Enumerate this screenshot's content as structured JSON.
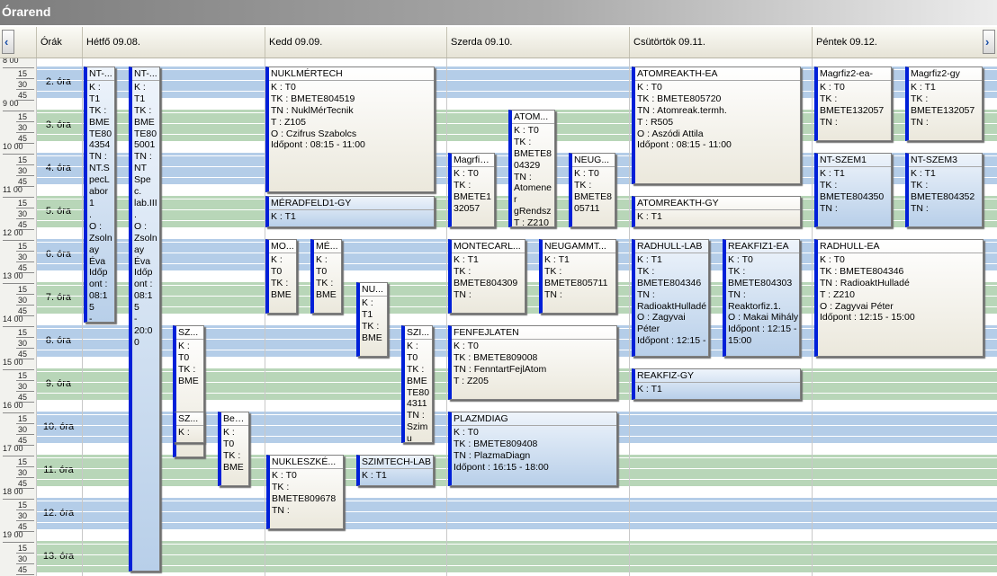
{
  "title": "Órarend",
  "header": {
    "hours_col": "Órák",
    "days": [
      "Hétfő  09.08.",
      "Kedd  09.09.",
      "Szerda  09.10.",
      "Csütörtök  09.11.",
      "Péntek  09.12."
    ]
  },
  "colors": {
    "band_blue": "#b4cde8",
    "band_green": "#b8d6b8",
    "event_accent": "#0020d8"
  },
  "icons": {
    "prev": "chevron-left-icon",
    "next": "chevron-right-icon"
  },
  "time_labels": [
    "8 00",
    "15",
    "30",
    "45",
    "9 00",
    "15",
    "30",
    "45",
    "10 00",
    "15",
    "30",
    "45",
    "11 00",
    "15",
    "30",
    "45",
    "12 00",
    "15",
    "30",
    "45",
    "13 00",
    "15",
    "30",
    "45",
    "14 00",
    "15",
    "30",
    "45",
    "15 00",
    "15",
    "30",
    "45",
    "16 00",
    "15",
    "30",
    "45",
    "17 00",
    "15",
    "30",
    "45",
    "18 00",
    "15",
    "30",
    "45",
    "19 00",
    "15",
    "30",
    "45"
  ],
  "periods": [
    "2. óra",
    "3. óra",
    "4. óra",
    "5. óra",
    "6. óra",
    "7. óra",
    "8. óra",
    "9. óra",
    "10. óra",
    "11. óra",
    "12. óra",
    "13. óra"
  ],
  "events": [
    {
      "title": "NT-...",
      "lines": [
        "K :",
        "T1",
        "TK :",
        "BME",
        "TE80",
        "4354",
        "TN :",
        "NT.S",
        "pecL",
        "abor1",
        ".",
        "O :",
        "Zsoln",
        "ay",
        "Éva",
        "Időp",
        "ont :",
        "08:15",
        "-"
      ]
    },
    {
      "title": "NT-...",
      "lines": [
        "K :",
        "T1",
        "TK :",
        "BME",
        "TE80",
        "5001",
        "TN :",
        "NT",
        "Spec.",
        "lab.III",
        ".",
        "O :",
        "Zsoln",
        "ay",
        "Éva",
        "Időp",
        "ont :",
        "08:15",
        "-",
        "20:00"
      ]
    },
    {
      "title": "SZ...",
      "lines": [
        "K :",
        "T0",
        "TK :",
        "BME"
      ]
    },
    {
      "title": "SZ...",
      "lines": [
        "K :"
      ]
    },
    {
      "title": "Bev...",
      "lines": [
        "K :",
        "T0",
        "TK :",
        "BME"
      ]
    },
    {
      "title": "NUKLMÉRTECH",
      "lines": [
        "K : T0",
        "TK : BMETE804519",
        "TN : NuklMérTecnik",
        "T : Z105",
        "O : Czifrus Szabolcs",
        "Időpont : 08:15 - 11:00"
      ]
    },
    {
      "title": "MÉRADFELD1-GY",
      "lines": [
        "K : T1"
      ]
    },
    {
      "title": "MO...",
      "lines": [
        "K :",
        "T0",
        "TK :",
        "BME"
      ]
    },
    {
      "title": "MÉ...",
      "lines": [
        "K :",
        "T0",
        "TK :",
        "BME"
      ]
    },
    {
      "title": "NU...",
      "lines": [
        "K :",
        "T1",
        "TK :",
        "BME"
      ]
    },
    {
      "title": "SZI...",
      "lines": [
        "K :",
        "T0",
        "TK :",
        "BME",
        "TE80",
        "4311",
        "TN :",
        "Szimu"
      ]
    },
    {
      "title": "NUKLESZKÉ...",
      "lines": [
        "K : T0",
        "TK :",
        "BMETE809678",
        "TN :"
      ]
    },
    {
      "title": "SZIMTECH-LAB",
      "lines": [
        "K : T1"
      ]
    },
    {
      "title": "Magrfiz...",
      "lines": [
        "K : T0",
        "TK :",
        "BMETE1",
        "32057"
      ]
    },
    {
      "title": "ATOM...",
      "lines": [
        "K : T0",
        "TK :",
        "BMETE8",
        "04329",
        "TN :",
        "Atomener",
        "gRendsz",
        "T : Z210"
      ]
    },
    {
      "title": "NEUG...",
      "lines": [
        "K : T0",
        "TK :",
        "BMETE8",
        "05711"
      ]
    },
    {
      "title": "MONTECARL...",
      "lines": [
        "K : T1",
        "TK :",
        "BMETE804309",
        "TN :"
      ]
    },
    {
      "title": "NEUGAMMT...",
      "lines": [
        "K : T1",
        "TK :",
        "BMETE805711",
        "TN :"
      ]
    },
    {
      "title": "FENFEJLATEN",
      "lines": [
        "K : T0",
        "TK : BMETE809008",
        "TN : FenntartFejlAtom",
        "T : Z205"
      ]
    },
    {
      "title": "PLAZMDIAG",
      "lines": [
        "K : T0",
        "TK : BMETE809408",
        "TN : PlazmaDiagn",
        "Időpont : 16:15 - 18:00"
      ]
    },
    {
      "title": "ATOMREAKTH-EA",
      "lines": [
        "K : T0",
        "TK : BMETE805720",
        "TN : Atomreak.termh.",
        "T : R505",
        "O : Aszódi Attila",
        "Időpont : 08:15 - 11:00"
      ]
    },
    {
      "title": "ATOMREAKTH-GY",
      "lines": [
        "K : T1"
      ]
    },
    {
      "title": "RADHULL-LAB",
      "lines": [
        "K : T1",
        "TK :",
        "BMETE804346",
        "TN :",
        "RadioaktHulladé",
        "O : Zagyvai",
        "Péter",
        "Időpont : 12:15 -"
      ]
    },
    {
      "title": "REAKFIZ1-EA",
      "lines": [
        "K : T0",
        "TK :",
        "BMETE804303",
        "TN :",
        "Reaktorfiz.1.",
        "O : Makai Mihály",
        "Időpont : 12:15 -",
        "15:00"
      ]
    },
    {
      "title": "REAKFIZ-GY",
      "lines": [
        "K : T1"
      ]
    },
    {
      "title": "Magrfiz2-ea-",
      "lines": [
        "K : T0",
        "TK :",
        "BMETE132057",
        "TN :"
      ]
    },
    {
      "title": "Magrfiz2-gy",
      "lines": [
        "K : T1",
        "TK :",
        "BMETE132057",
        "TN :"
      ]
    },
    {
      "title": "NT-SZEM1",
      "lines": [
        "K : T1",
        "TK :",
        "BMETE804350",
        "TN :"
      ]
    },
    {
      "title": "NT-SZEM3",
      "lines": [
        "K : T1",
        "TK :",
        "BMETE804352",
        "TN :"
      ]
    },
    {
      "title": "RADHULL-EA",
      "lines": [
        "K : T0",
        "TK : BMETE804346",
        "TN : RadioaktHulladé",
        "T : Z210",
        "O : Zagyvai Péter",
        "Időpont : 12:15 - 15:00"
      ]
    }
  ]
}
